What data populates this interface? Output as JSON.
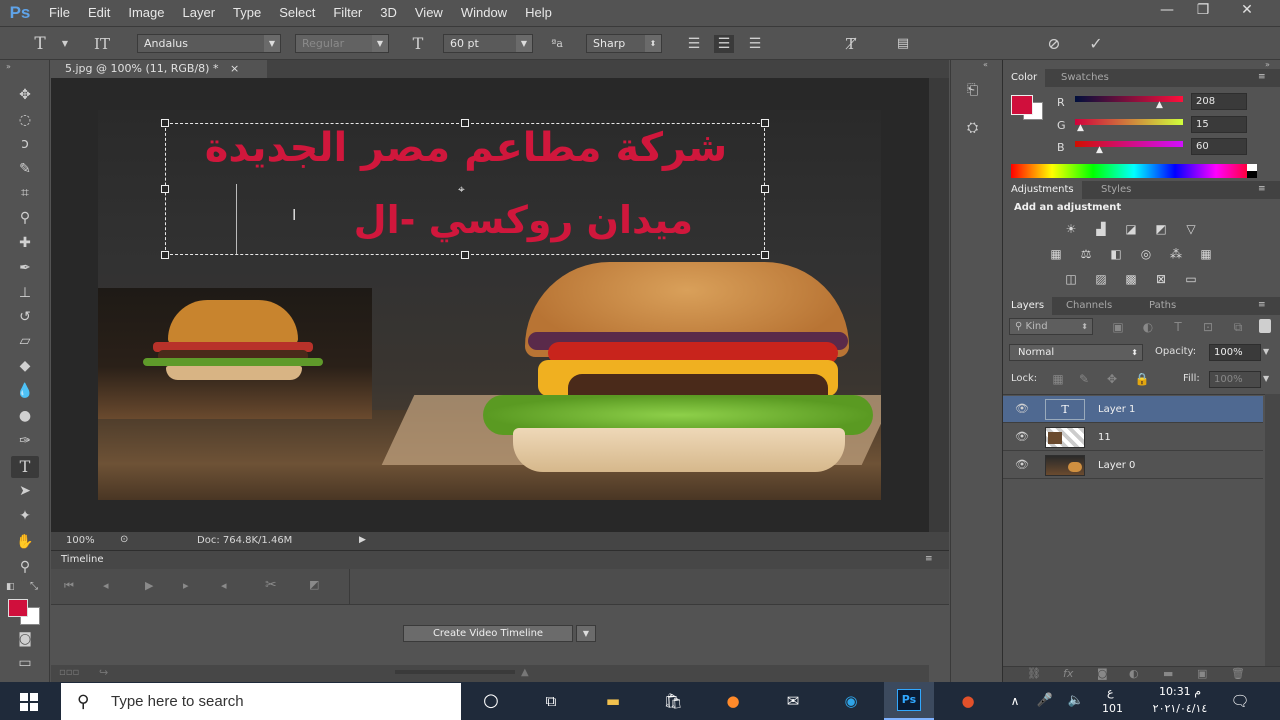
{
  "app": {
    "logo": "Ps",
    "menu": [
      "File",
      "Edit",
      "Image",
      "Layer",
      "Type",
      "Select",
      "Filter",
      "3D",
      "View",
      "Window",
      "Help"
    ],
    "window_controls": {
      "minimize": "—",
      "restore": "❐",
      "close": "✕"
    }
  },
  "options_bar": {
    "font_family": "Andalus",
    "font_style": "Regular",
    "font_size": "60 pt",
    "aa_label": "ªa",
    "anti_alias": "Sharp",
    "text_color": "#d60f3c"
  },
  "document": {
    "tab_title": "5.jpg @ 100% (11, RGB/8) *",
    "tab_close": "×",
    "text_line1": "شركة مطاعم مصر الجديدة",
    "text_line2": "ميدان روكسي -ال"
  },
  "status_bar": {
    "zoom": "100%",
    "doc_info": "Doc: 764.8K/1.46M"
  },
  "timeline": {
    "tab": "Timeline",
    "create_button": "Create Video Timeline"
  },
  "color_panel": {
    "tabs": [
      "Color",
      "Swatches"
    ],
    "r_label": "R",
    "g_label": "G",
    "b_label": "B",
    "r": "208",
    "g": "15",
    "b": "60",
    "foreground": "#d00f3c"
  },
  "adjustments_panel": {
    "tabs": [
      "Adjustments",
      "Styles"
    ],
    "title": "Add an adjustment"
  },
  "layers_panel": {
    "tabs": [
      "Layers",
      "Channels",
      "Paths"
    ],
    "kind": "Kind",
    "blend_mode": "Normal",
    "opacity_label": "Opacity:",
    "opacity": "100%",
    "lock_label": "Lock:",
    "fill_label": "Fill:",
    "fill": "100%",
    "layers": [
      {
        "name": "Layer 1",
        "selected": true
      },
      {
        "name": "11",
        "selected": false
      },
      {
        "name": "Layer 0",
        "selected": false
      }
    ]
  },
  "taskbar": {
    "search_placeholder": "Type here to search",
    "time": "10:31 م",
    "date": "٢٠٢١/٠٤/١٤",
    "lang": "ع",
    "notif_count": "101"
  }
}
